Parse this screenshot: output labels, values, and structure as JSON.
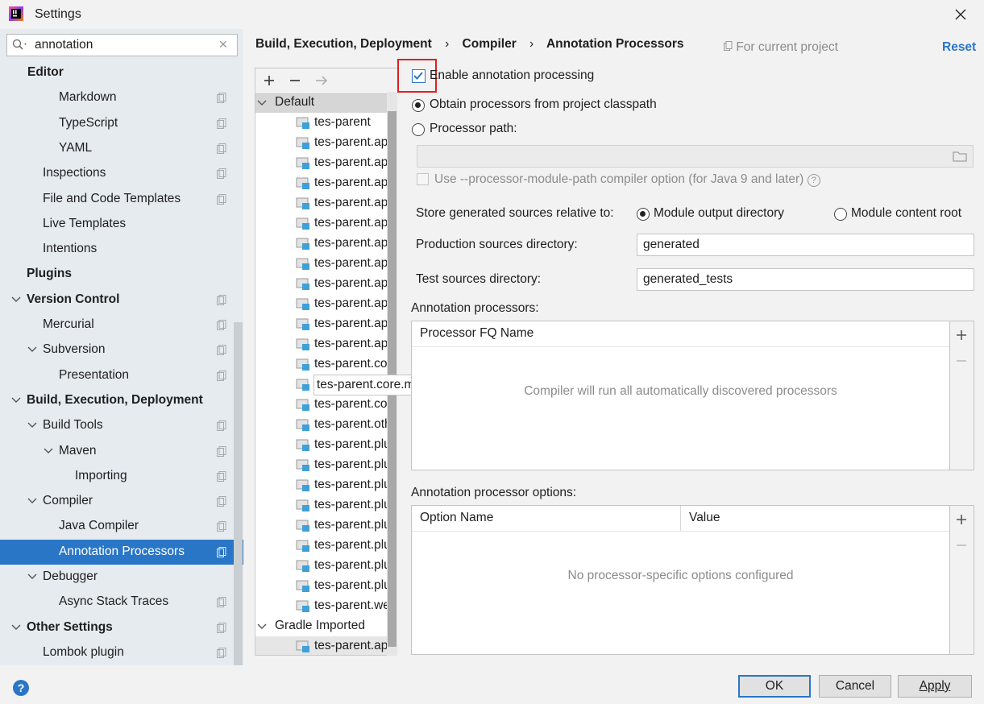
{
  "window": {
    "title": "Settings"
  },
  "search": {
    "value": "annotation"
  },
  "sidebar": {
    "items": [
      {
        "label": "Editor",
        "bold": true
      },
      {
        "label": "Markdown"
      },
      {
        "label": "TypeScript"
      },
      {
        "label": "YAML"
      },
      {
        "label": "Inspections"
      },
      {
        "label": "File and Code Templates"
      },
      {
        "label": "Live Templates"
      },
      {
        "label": "Intentions"
      },
      {
        "label": "Plugins",
        "bold": true
      },
      {
        "label": "Version Control",
        "bold": true
      },
      {
        "label": "Mercurial"
      },
      {
        "label": "Subversion"
      },
      {
        "label": "Presentation"
      },
      {
        "label": "Build, Execution, Deployment",
        "bold": true
      },
      {
        "label": "Build Tools"
      },
      {
        "label": "Maven"
      },
      {
        "label": "Importing"
      },
      {
        "label": "Compiler"
      },
      {
        "label": "Java Compiler"
      },
      {
        "label": "Annotation Processors",
        "selected": true
      },
      {
        "label": "Debugger"
      },
      {
        "label": "Async Stack Traces"
      },
      {
        "label": "Other Settings",
        "bold": true
      },
      {
        "label": "Lombok plugin"
      }
    ]
  },
  "breadcrumb": {
    "parts": [
      "Build, Execution, Deployment",
      "Compiler",
      "Annotation Processors"
    ],
    "scope": "For current project",
    "reset": "Reset"
  },
  "profiles": {
    "default_group": "Default",
    "modules": [
      "tes-parent",
      "tes-parent.app",
      "tes-parent.app",
      "tes-parent.app",
      "tes-parent.app",
      "tes-parent.app",
      "tes-parent.app",
      "tes-parent.app",
      "tes-parent.app",
      "tes-parent.app",
      "tes-parent.app",
      "tes-parent.app",
      "tes-parent.cor",
      "tes-parent.core.main",
      "tes-parent.cor",
      "tes-parent.oth",
      "tes-parent.plu",
      "tes-parent.plu",
      "tes-parent.plu",
      "tes-parent.plu",
      "tes-parent.plu",
      "tes-parent.plu",
      "tes-parent.plu",
      "tes-parent.plu",
      "tes-parent.wel"
    ],
    "gradle_group": "Gradle Imported",
    "gradle_modules": [
      "tes-parent.app"
    ]
  },
  "form": {
    "enable_label": "Enable annotation processing",
    "enable_checked": true,
    "obtain_label": "Obtain processors from project classpath",
    "processor_path_label": "Processor path:",
    "module_path_label": "Use --processor-module-path compiler option (for Java 9 and later)",
    "store_label": "Store generated sources relative to:",
    "store_option_output": "Module output directory",
    "store_option_content": "Module content root",
    "production_label": "Production sources directory:",
    "production_value": "generated",
    "test_label": "Test sources directory:",
    "test_value": "generated_tests",
    "processors_label": "Annotation processors:",
    "processors_col": "Processor FQ Name",
    "processors_empty": "Compiler will run all automatically discovered processors",
    "options_label": "Annotation processor options:",
    "options_col_name": "Option Name",
    "options_col_value": "Value",
    "options_empty": "No processor-specific options configured"
  },
  "buttons": {
    "ok": "OK",
    "cancel": "Cancel",
    "apply": "Apply"
  },
  "colors": {
    "accent": "#2a76c6",
    "highlight_box": "#e02020"
  }
}
